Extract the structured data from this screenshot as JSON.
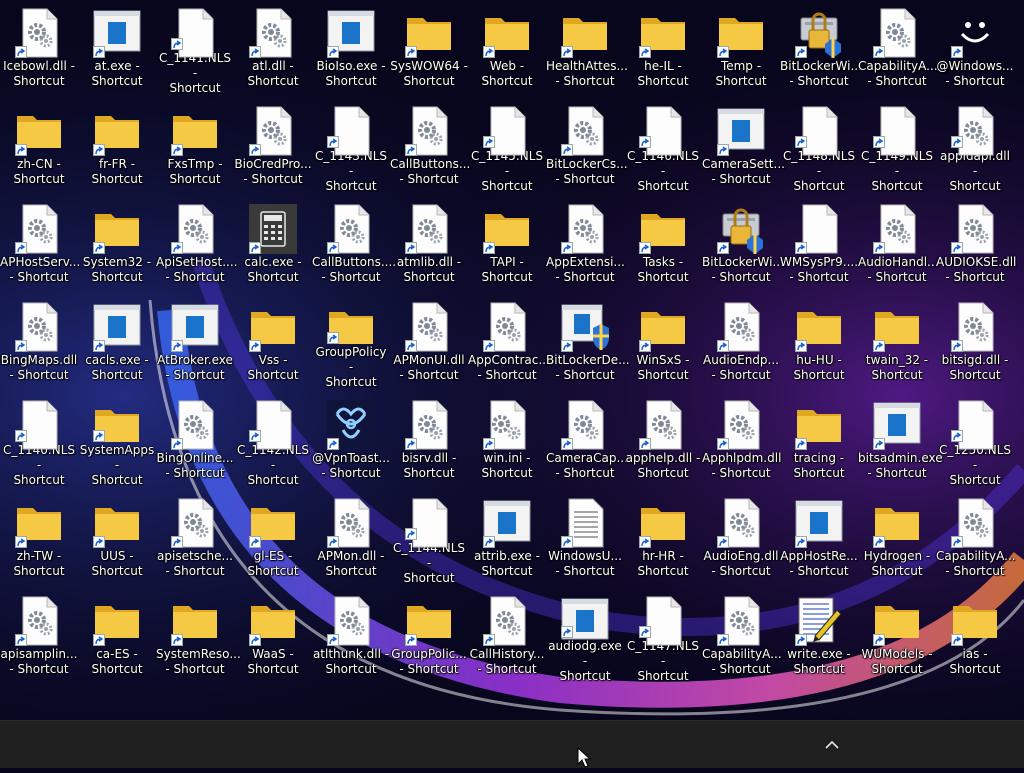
{
  "desktop": {
    "columns": [
      [
        {
          "label": "Icebowl.dll -\nShortcut",
          "icon": "dll-gear-icon"
        },
        {
          "label": "zh-CN -\nShortcut",
          "icon": "folder-icon"
        },
        {
          "label": "APHostServ...\n- Shortcut",
          "icon": "dll-gear-icon"
        },
        {
          "label": "BingMaps.dll\n- Shortcut",
          "icon": "dll-gear-icon"
        },
        {
          "label": "C_1140.NLS -\nShortcut",
          "icon": "blank-file-icon"
        },
        {
          "label": "zh-TW -\nShortcut",
          "icon": "folder-icon"
        },
        {
          "label": "apisamplin...\n- Shortcut",
          "icon": "dll-gear-icon"
        }
      ],
      [
        {
          "label": "at.exe -\nShortcut",
          "icon": "exe-window-icon"
        },
        {
          "label": "fr-FR -\nShortcut",
          "icon": "folder-icon"
        },
        {
          "label": "System32 -\nShortcut",
          "icon": "folder-icon"
        },
        {
          "label": "cacls.exe -\nShortcut",
          "icon": "exe-window-icon"
        },
        {
          "label": "SystemApps -\nShortcut",
          "icon": "folder-icon"
        },
        {
          "label": "UUS -\nShortcut",
          "icon": "folder-icon"
        },
        {
          "label": "ca-ES -\nShortcut",
          "icon": "folder-icon"
        }
      ],
      [
        {
          "label": "C_1141.NLS -\nShortcut",
          "icon": "blank-file-icon"
        },
        {
          "label": "FxsTmp -\nShortcut",
          "icon": "folder-icon"
        },
        {
          "label": "ApiSetHost....\n- Shortcut",
          "icon": "dll-gear-icon"
        },
        {
          "label": "AtBroker.exe\n- Shortcut",
          "icon": "exe-window-icon"
        },
        {
          "label": "BingOnline...\n- Shortcut",
          "icon": "dll-gear-icon"
        },
        {
          "label": "apisetsche...\n- Shortcut",
          "icon": "dll-gear-icon"
        },
        {
          "label": "SystemReso...\n- Shortcut",
          "icon": "folder-icon"
        }
      ],
      [
        {
          "label": "atl.dll -\nShortcut",
          "icon": "dll-gear-icon"
        },
        {
          "label": "BioCredPro...\n- Shortcut",
          "icon": "dll-gear-icon"
        },
        {
          "label": "calc.exe -\nShortcut",
          "icon": "calculator-icon"
        },
        {
          "label": "Vss - Shortcut",
          "icon": "folder-icon"
        },
        {
          "label": "C_1142.NLS -\nShortcut",
          "icon": "blank-file-icon"
        },
        {
          "label": "gl-ES -\nShortcut",
          "icon": "folder-icon"
        },
        {
          "label": "WaaS -\nShortcut",
          "icon": "folder-icon"
        }
      ],
      [
        {
          "label": "BioIso.exe -\nShortcut",
          "icon": "exe-window-icon"
        },
        {
          "label": "C_1143.NLS -\nShortcut",
          "icon": "blank-file-icon"
        },
        {
          "label": "CallButtons....\n- Shortcut",
          "icon": "dll-gear-icon"
        },
        {
          "label": "GroupPolicy -\nShortcut",
          "icon": "folder-icon"
        },
        {
          "label": "@VpnToast...\n- Shortcut",
          "icon": "vpn-toast-icon"
        },
        {
          "label": "APMon.dll -\nShortcut",
          "icon": "dll-gear-icon"
        },
        {
          "label": "atlthunk.dll -\nShortcut",
          "icon": "dll-gear-icon"
        }
      ],
      [
        {
          "label": "SysWOW64 -\nShortcut",
          "icon": "folder-icon"
        },
        {
          "label": "CallButtons...\n- Shortcut",
          "icon": "dll-gear-icon"
        },
        {
          "label": "atmlib.dll -\nShortcut",
          "icon": "dll-gear-icon"
        },
        {
          "label": "APMonUI.dll\n- Shortcut",
          "icon": "dll-gear-icon"
        },
        {
          "label": "bisrv.dll -\nShortcut",
          "icon": "dll-gear-icon"
        },
        {
          "label": "C_1144.NLS -\nShortcut",
          "icon": "blank-file-icon"
        },
        {
          "label": "GroupPolic...\n- Shortcut",
          "icon": "folder-icon"
        }
      ],
      [
        {
          "label": "Web -\nShortcut",
          "icon": "folder-icon"
        },
        {
          "label": "C_1145.NLS -\nShortcut",
          "icon": "blank-file-icon"
        },
        {
          "label": "TAPI -\nShortcut",
          "icon": "folder-icon"
        },
        {
          "label": "AppContrac...\n- Shortcut",
          "icon": "dll-gear-icon"
        },
        {
          "label": "win.ini -\nShortcut",
          "icon": "ini-gear-icon"
        },
        {
          "label": "attrib.exe -\nShortcut",
          "icon": "exe-window-icon"
        },
        {
          "label": "CallHistory...\n- Shortcut",
          "icon": "dll-gear-icon"
        }
      ],
      [
        {
          "label": "HealthAttes...\n- Shortcut",
          "icon": "folder-icon"
        },
        {
          "label": "BitLockerCs...\n- Shortcut",
          "icon": "dll-gear-icon"
        },
        {
          "label": "AppExtensi...\n- Shortcut",
          "icon": "dll-gear-icon"
        },
        {
          "label": "BitLockerDe...\n- Shortcut",
          "icon": "bitlocker-shield-icon"
        },
        {
          "label": "CameraCap...\n- Shortcut",
          "icon": "dll-gear-icon"
        },
        {
          "label": "WindowsU...\n- Shortcut",
          "icon": "text-document-icon"
        },
        {
          "label": "audiodg.exe -\nShortcut",
          "icon": "exe-window-icon"
        }
      ],
      [
        {
          "label": "he-IL -\nShortcut",
          "icon": "folder-icon"
        },
        {
          "label": "C_1146.NLS -\nShortcut",
          "icon": "blank-file-icon"
        },
        {
          "label": "Tasks -\nShortcut",
          "icon": "folder-icon"
        },
        {
          "label": "WinSxS -\nShortcut",
          "icon": "folder-icon"
        },
        {
          "label": "apphelp.dll -\nShortcut",
          "icon": "dll-gear-icon"
        },
        {
          "label": "hr-HR -\nShortcut",
          "icon": "folder-icon"
        },
        {
          "label": "C_1147.NLS -\nShortcut",
          "icon": "blank-file-icon"
        }
      ],
      [
        {
          "label": "Temp -\nShortcut",
          "icon": "folder-icon"
        },
        {
          "label": "CameraSett...\n- Shortcut",
          "icon": "exe-window-icon"
        },
        {
          "label": "BitLockerWi...\n- Shortcut",
          "icon": "bitlocker-lock-icon"
        },
        {
          "label": "AudioEndp...\n- Shortcut",
          "icon": "dll-gear-icon"
        },
        {
          "label": "Apphlpdm.dll\n- Shortcut",
          "icon": "dll-gear-icon"
        },
        {
          "label": "AudioEng.dll\n- Shortcut",
          "icon": "dll-gear-icon"
        },
        {
          "label": "CapabilityA...\n- Shortcut",
          "icon": "dll-gear-icon"
        }
      ],
      [
        {
          "label": "BitLockerWi...\n- Shortcut",
          "icon": "bitlocker-lock-icon"
        },
        {
          "label": "C_1148.NLS -\nShortcut",
          "icon": "blank-file-icon"
        },
        {
          "label": "WMSysPr9....\n- Shortcut",
          "icon": "blank-file-icon"
        },
        {
          "label": "hu-HU -\nShortcut",
          "icon": "folder-icon"
        },
        {
          "label": "tracing -\nShortcut",
          "icon": "folder-icon"
        },
        {
          "label": "AppHostRe...\n- Shortcut",
          "icon": "exe-window-icon"
        },
        {
          "label": "write.exe -\nShortcut",
          "icon": "write-notepad-icon"
        }
      ],
      [
        {
          "label": "CapabilityA...\n- Shortcut",
          "icon": "dll-gear-icon"
        },
        {
          "label": "C_1149.NLS -\nShortcut",
          "icon": "blank-file-icon"
        },
        {
          "label": "AudioHandl...\n- Shortcut",
          "icon": "dll-gear-icon"
        },
        {
          "label": "twain_32 -\nShortcut",
          "icon": "folder-icon"
        },
        {
          "label": "bitsadmin.exe\n- Shortcut",
          "icon": "exe-window-icon"
        },
        {
          "label": "Hydrogen -\nShortcut",
          "icon": "folder-icon"
        },
        {
          "label": "WUModels -\nShortcut",
          "icon": "folder-icon"
        }
      ],
      [
        {
          "label": "@Windows...\n- Shortcut",
          "icon": "smiley-icon"
        },
        {
          "label": "appidapi.dll -\nShortcut",
          "icon": "dll-gear-icon"
        },
        {
          "label": "AUDIOKSE.dll\n- Shortcut",
          "icon": "dll-gear-icon"
        },
        {
          "label": "bitsigd.dll -\nShortcut",
          "icon": "dll-gear-icon"
        },
        {
          "label": "C_1250.NLS -\nShortcut",
          "icon": "blank-file-icon"
        },
        {
          "label": "CapabilityA...\n- Shortcut",
          "icon": "dll-gear-icon"
        },
        {
          "label": "ias - Shortcut",
          "icon": "folder-icon"
        }
      ]
    ]
  },
  "taskbar": {
    "tray_chevron_icon": "chevron-up-icon"
  },
  "colors": {
    "folder": "#f6c945",
    "folder_dark": "#e0a820",
    "exe_blue": "#1a74c9",
    "taskbar": "#202020",
    "wallpaper_glow": "#c23cff"
  }
}
